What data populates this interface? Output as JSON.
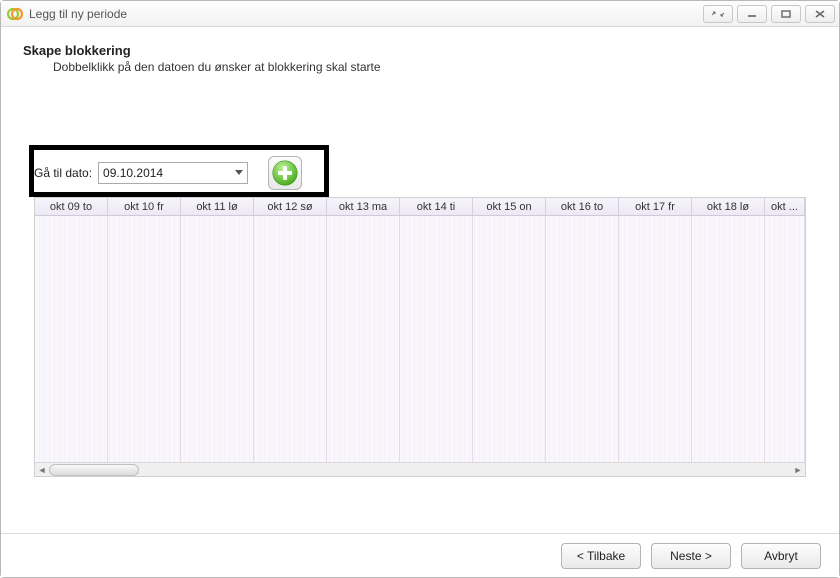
{
  "window": {
    "title": "Legg til ny periode"
  },
  "heading": "Skape blokkering",
  "subheading": "Dobbelklikk på den datoen du ønsker at blokkering skal starte",
  "date": {
    "label": "Gå til dato:",
    "value": "09.10.2014"
  },
  "calendar": {
    "columns": [
      "okt 09 to",
      "okt 10 fr",
      "okt 11 lø",
      "okt 12 sø",
      "okt 13 ma",
      "okt 14 ti",
      "okt 15 on",
      "okt 16 to",
      "okt 17 fr",
      "okt 18 lø"
    ],
    "overflow_label": "okt ..."
  },
  "footer": {
    "back": "< Tilbake",
    "next": "Neste >",
    "cancel": "Avbryt"
  }
}
